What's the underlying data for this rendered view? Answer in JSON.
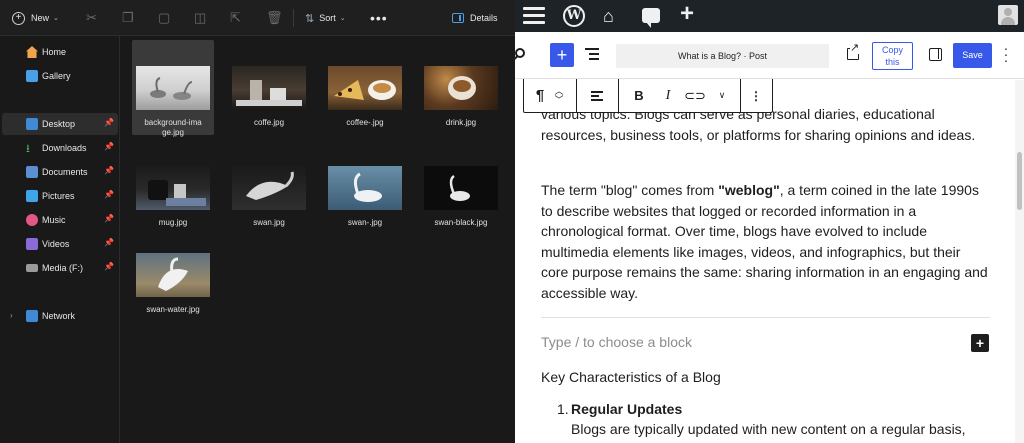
{
  "explorer": {
    "toolbar": {
      "new_label": "New",
      "sort_label": "Sort",
      "details_label": "Details"
    },
    "nav": [
      {
        "label": "Home",
        "icon": "home-icon",
        "color": "#f0a54b"
      },
      {
        "label": "Gallery",
        "icon": "gallery-icon",
        "color": "#4aa0e6"
      },
      {
        "label": "Desktop",
        "icon": "desktop-icon",
        "color": "#3f8ad8",
        "pinned": true,
        "selected": true
      },
      {
        "label": "Downloads",
        "icon": "downloads-icon",
        "color": "#4fb06e",
        "pinned": true
      },
      {
        "label": "Documents",
        "icon": "documents-icon",
        "color": "#5a8fd0",
        "pinned": true
      },
      {
        "label": "Pictures",
        "icon": "pictures-icon",
        "color": "#3ea6e8",
        "pinned": true
      },
      {
        "label": "Music",
        "icon": "music-icon",
        "color": "#e0588a",
        "pinned": true
      },
      {
        "label": "Videos",
        "icon": "videos-icon",
        "color": "#8c6ad8",
        "pinned": true
      },
      {
        "label": "Media (F:)",
        "icon": "drive-icon",
        "color": "#9a9a9a",
        "pinned": true
      },
      {
        "label": "Network",
        "icon": "network-icon",
        "color": "#3f8ad8"
      }
    ],
    "files": [
      {
        "name": "background-ima\nge.jpg",
        "selected": true
      },
      {
        "name": "coffe.jpg"
      },
      {
        "name": "coffee-.jpg"
      },
      {
        "name": "drink.jpg"
      },
      {
        "name": "mug.jpg"
      },
      {
        "name": "swan.jpg"
      },
      {
        "name": "swan-.jpg"
      },
      {
        "name": "swan-black.jpg"
      },
      {
        "name": "swan-water.jpg"
      }
    ]
  },
  "wp": {
    "doc_title": "What is a Blog? · Post",
    "copy_label": "Copy this",
    "save_label": "Save",
    "paragraph1": "various topics. Blogs can serve as personal diaries, educational resources, business tools, or platforms for sharing opinions and ideas.",
    "paragraph2_before": "The term \"blog\" comes from ",
    "paragraph2_bold": "\"weblog\"",
    "paragraph2_after": ", a term coined in the late 1990s to describe websites that logged or recorded information in a chronological format. Over time, blogs have evolved to include multimedia elements like images, videos, and infographics, but their core purpose remains the same: sharing information in an engaging and accessible way.",
    "placeholder": "Type / to choose a block",
    "heading": "Key Characteristics of a Blog",
    "list_number": "1.",
    "list_title": "Regular Updates",
    "list_text": "Blogs are typically updated with new content on a regular basis,"
  },
  "colors": {
    "explorer_bg": "#191919",
    "wp_admin_bar": "#1d2327",
    "wp_accent": "#3858e9"
  }
}
